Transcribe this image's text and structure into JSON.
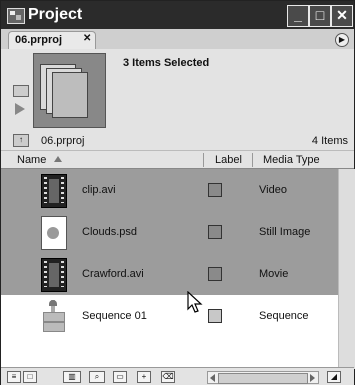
{
  "window": {
    "title": "Project",
    "controls": {
      "minimize": "_",
      "maximize": "□",
      "close": "✕"
    }
  },
  "tab": {
    "label": "06.prproj",
    "close": "✕"
  },
  "preview": {
    "summary": "3 Items Selected"
  },
  "bin": {
    "name": "06.prproj",
    "count": "4 Items"
  },
  "columns": {
    "name": "Name",
    "label": "Label",
    "media_type": "Media Type"
  },
  "items": [
    {
      "name": "clip.avi",
      "type": "Video",
      "icon": "film-icon",
      "selected": true
    },
    {
      "name": "Clouds.psd",
      "type": "Still Image",
      "icon": "photoshop-file-icon",
      "selected": true
    },
    {
      "name": "Crawford.avi",
      "type": "Movie",
      "icon": "film-audio-icon",
      "selected": true
    },
    {
      "name": "Sequence 01",
      "type": "Sequence",
      "icon": "sequence-icon",
      "selected": false
    }
  ]
}
